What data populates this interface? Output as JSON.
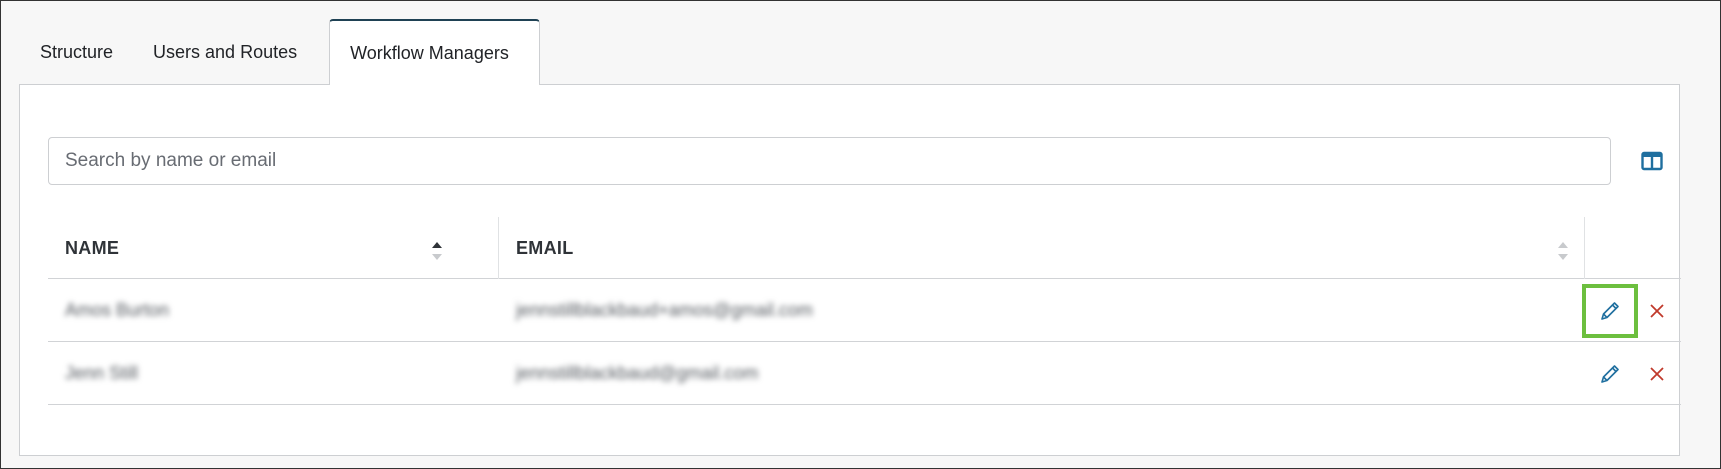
{
  "tabs": [
    {
      "label": "Structure",
      "active": false
    },
    {
      "label": "Users and Routes",
      "active": false
    },
    {
      "label": "Workflow Managers",
      "active": true
    }
  ],
  "search": {
    "placeholder": "Search by name or email",
    "value": ""
  },
  "column_chooser_icon": "columns-icon",
  "table": {
    "columns": [
      {
        "label": "NAME",
        "sort": "ascending"
      },
      {
        "label": "EMAIL",
        "sort": "none"
      }
    ],
    "rows": [
      {
        "name": "Amos Burton",
        "email": "jennstillblackbaud+amos@gmail.com",
        "edit_highlighted": true
      },
      {
        "name": "Jenn Still",
        "email": "jennstillblackbaud@gmail.com",
        "edit_highlighted": false
      }
    ]
  },
  "icons": {
    "edit": "pencil-icon",
    "delete": "close-icon"
  },
  "colors": {
    "active_tab_border": "#1f4154",
    "icon_blue": "#1f6f9f",
    "delete_red": "#c0392b",
    "highlight_green": "#6cbf3e",
    "sort_active": "#2f3338",
    "sort_inactive": "#c8cacd"
  }
}
